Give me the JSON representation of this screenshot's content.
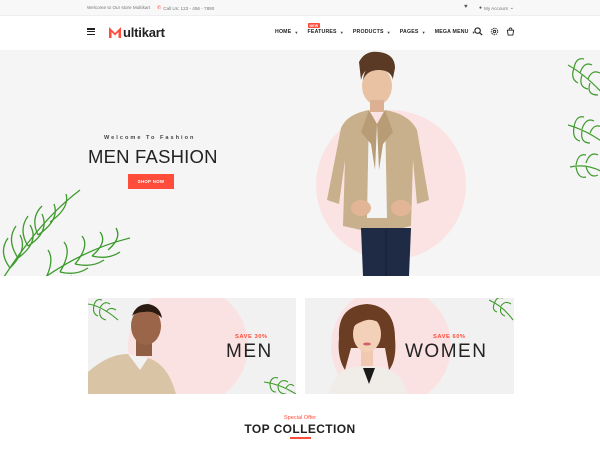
{
  "topbar": {
    "welcome": "Welcome to Our store Multikart",
    "phone": "Call Us: 123 - 456 - 7890",
    "account": "My Account"
  },
  "header": {
    "logo_letter": "M",
    "logo_rest": "ultikart",
    "nav": [
      {
        "label": "HOME",
        "has_dropdown": true
      },
      {
        "label": "FEATURES",
        "has_dropdown": true,
        "badge": "NEW"
      },
      {
        "label": "PRODUCTS",
        "has_dropdown": true
      },
      {
        "label": "PAGES",
        "has_dropdown": true
      },
      {
        "label": "MEGA MENU",
        "has_dropdown": true
      }
    ],
    "icons": [
      "search-icon",
      "settings-icon",
      "cart-icon"
    ]
  },
  "hero": {
    "welcome": "Welcome To Fashion",
    "title": "MEN FASHION",
    "button": "SHOP NOW"
  },
  "banners": [
    {
      "save": "SAVE 30%",
      "title": "MEN"
    },
    {
      "save": "SAVE 60%",
      "title": "WOMEN"
    }
  ],
  "collection": {
    "subtitle": "Special Offer",
    "title": "TOP COLLECTION"
  },
  "colors": {
    "accent": "#ff4c3b",
    "circle": "#fbe3e3",
    "leaf": "#3f9b2c"
  }
}
